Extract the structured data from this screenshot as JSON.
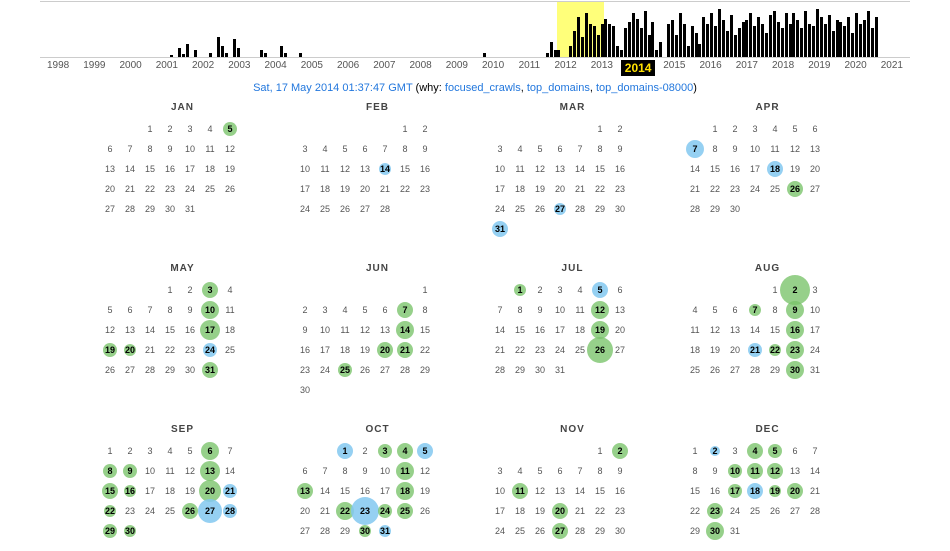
{
  "timeline": {
    "years": [
      "1998",
      "1999",
      "2000",
      "2001",
      "2002",
      "2003",
      "2004",
      "2005",
      "2006",
      "2007",
      "2008",
      "2009",
      "2010",
      "2011",
      "2012",
      "2013",
      "2014",
      "2015",
      "2016",
      "2017",
      "2018",
      "2019",
      "2020",
      "2021"
    ],
    "selected": "2014",
    "bars": {
      "2003": [
        0,
        0,
        0,
        2,
        0,
        8,
        3,
        12,
        0,
        6,
        0,
        0
      ],
      "2004": [
        0,
        4,
        0,
        18,
        10,
        4,
        0,
        16,
        8,
        0,
        0,
        0
      ],
      "2005": [
        0,
        0,
        6,
        4,
        0,
        0,
        0,
        10,
        4,
        0,
        0,
        0
      ],
      "2006": [
        4,
        0,
        0,
        0,
        0,
        0,
        0,
        0,
        0,
        0,
        0,
        0
      ],
      "2012": [
        0,
        0,
        0,
        0,
        0,
        4,
        0,
        0,
        0,
        0,
        0,
        0
      ],
      "2013": [
        0,
        0,
        0,
        0,
        0,
        0,
        0,
        0,
        0,
        4,
        14,
        6
      ],
      "2014": [
        6,
        0,
        0,
        10,
        24,
        36,
        18,
        40,
        30,
        28,
        20,
        30
      ],
      "2015": [
        35,
        30,
        28,
        10,
        6,
        26,
        32,
        40,
        35,
        26,
        42,
        20
      ],
      "2016": [
        32,
        6,
        14,
        0,
        30,
        34,
        20,
        40,
        30,
        10,
        28,
        22
      ],
      "2017": [
        12,
        36,
        30,
        40,
        28,
        44,
        34,
        24,
        38,
        20,
        26,
        32
      ],
      "2018": [
        34,
        40,
        28,
        36,
        30,
        22,
        38,
        42,
        32,
        26,
        40,
        30
      ],
      "2019": [
        40,
        34,
        26,
        42,
        30,
        28,
        44,
        36,
        30,
        38,
        24,
        34
      ],
      "2020": [
        32,
        28,
        36,
        22,
        40,
        30,
        34,
        42,
        26,
        36,
        0,
        0
      ]
    }
  },
  "caption": {
    "datetime": "Sat, 17 May 2014 01:37:47 GMT",
    "why_label": "why:",
    "reasons": [
      "focused_crawls",
      "top_domains",
      "top_domains-08000"
    ]
  },
  "months": [
    {
      "name": "JAN",
      "offset": 2,
      "ndays": 31,
      "marks": {
        "5": {
          "c": "g",
          "s": 14
        }
      }
    },
    {
      "name": "FEB",
      "offset": 5,
      "ndays": 28,
      "marks": {
        "14": {
          "c": "b",
          "s": 12
        }
      }
    },
    {
      "name": "MAR",
      "offset": 5,
      "ndays": 31,
      "marks": {
        "27": {
          "c": "b",
          "s": 12
        },
        "31": {
          "c": "b",
          "s": 16
        }
      }
    },
    {
      "name": "APR",
      "offset": 1,
      "ndays": 30,
      "marks": {
        "7": {
          "c": "b",
          "s": 18
        },
        "18": {
          "c": "b",
          "s": 16
        },
        "26": {
          "c": "g",
          "s": 16
        }
      }
    },
    {
      "name": "MAY",
      "offset": 3,
      "ndays": 31,
      "marks": {
        "3": {
          "c": "g",
          "s": 16
        },
        "10": {
          "c": "g",
          "s": 18
        },
        "17": {
          "c": "g",
          "s": 20
        },
        "19": {
          "c": "g",
          "s": 14
        },
        "20": {
          "c": "g",
          "s": 12
        },
        "24": {
          "c": "b",
          "s": 14
        },
        "31": {
          "c": "g",
          "s": 16
        }
      }
    },
    {
      "name": "JUN",
      "offset": 6,
      "ndays": 30,
      "marks": {
        "7": {
          "c": "g",
          "s": 16
        },
        "14": {
          "c": "g",
          "s": 18
        },
        "20": {
          "c": "g",
          "s": 16
        },
        "21": {
          "c": "g",
          "s": 16
        },
        "25": {
          "c": "g",
          "s": 14
        }
      }
    },
    {
      "name": "JUL",
      "offset": 1,
      "ndays": 31,
      "marks": {
        "1": {
          "c": "g",
          "s": 12
        },
        "5": {
          "c": "b",
          "s": 16
        },
        "12": {
          "c": "g",
          "s": 18
        },
        "19": {
          "c": "g",
          "s": 18
        },
        "26": {
          "c": "g",
          "s": 26
        }
      }
    },
    {
      "name": "AUG",
      "offset": 4,
      "ndays": 31,
      "marks": {
        "2": {
          "c": "g",
          "s": 30
        },
        "7": {
          "c": "g",
          "s": 12
        },
        "9": {
          "c": "g",
          "s": 18
        },
        "16": {
          "c": "g",
          "s": 18
        },
        "21": {
          "c": "b",
          "s": 14
        },
        "22": {
          "c": "g",
          "s": 12
        },
        "23": {
          "c": "g",
          "s": 18
        },
        "30": {
          "c": "g",
          "s": 18
        }
      }
    },
    {
      "name": "SEP",
      "offset": 0,
      "ndays": 30,
      "marks": {
        "6": {
          "c": "g",
          "s": 18
        },
        "8": {
          "c": "g",
          "s": 14
        },
        "9": {
          "c": "g",
          "s": 14
        },
        "13": {
          "c": "g",
          "s": 20
        },
        "15": {
          "c": "g",
          "s": 16
        },
        "16": {
          "c": "g",
          "s": 12
        },
        "20": {
          "c": "g",
          "s": 22
        },
        "21": {
          "c": "b",
          "s": 14
        },
        "22": {
          "c": "g",
          "s": 12
        },
        "26": {
          "c": "g",
          "s": 16
        },
        "27": {
          "c": "b",
          "s": 24
        },
        "28": {
          "c": "b",
          "s": 14
        },
        "29": {
          "c": "g",
          "s": 14
        },
        "30": {
          "c": "g",
          "s": 12
        }
      }
    },
    {
      "name": "OCT",
      "offset": 2,
      "ndays": 31,
      "marks": {
        "1": {
          "c": "b",
          "s": 16
        },
        "3": {
          "c": "g",
          "s": 14
        },
        "4": {
          "c": "g",
          "s": 16
        },
        "5": {
          "c": "b",
          "s": 16
        },
        "11": {
          "c": "g",
          "s": 18
        },
        "13": {
          "c": "g",
          "s": 16
        },
        "18": {
          "c": "g",
          "s": 18
        },
        "22": {
          "c": "g",
          "s": 18
        },
        "23": {
          "c": "b",
          "s": 28
        },
        "24": {
          "c": "g",
          "s": 14
        },
        "25": {
          "c": "g",
          "s": 16
        },
        "30": {
          "c": "g",
          "s": 12
        },
        "31": {
          "c": "b",
          "s": 12
        }
      }
    },
    {
      "name": "NOV",
      "offset": 5,
      "ndays": 30,
      "marks": {
        "2": {
          "c": "g",
          "s": 16
        },
        "11": {
          "c": "g",
          "s": 16
        },
        "20": {
          "c": "g",
          "s": 16
        },
        "27": {
          "c": "g",
          "s": 16
        }
      }
    },
    {
      "name": "DEC",
      "offset": 0,
      "ndays": 31,
      "marks": {
        "2": {
          "c": "b",
          "s": 10
        },
        "4": {
          "c": "g",
          "s": 16
        },
        "5": {
          "c": "g",
          "s": 14
        },
        "10": {
          "c": "g",
          "s": 14
        },
        "11": {
          "c": "g",
          "s": 16
        },
        "12": {
          "c": "g",
          "s": 16
        },
        "17": {
          "c": "g",
          "s": 14
        },
        "18": {
          "c": "b",
          "s": 16
        },
        "19": {
          "c": "g",
          "s": 12
        },
        "20": {
          "c": "g",
          "s": 16
        },
        "23": {
          "c": "g",
          "s": 16
        },
        "30": {
          "c": "g",
          "s": 18
        }
      }
    }
  ]
}
